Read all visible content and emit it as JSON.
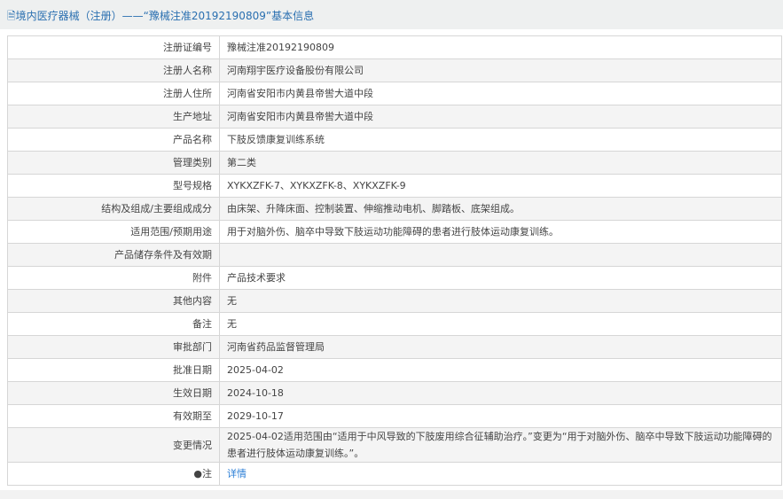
{
  "title": "🗎境内医疗器械（注册）——“豫械注准20192190809”基本信息",
  "rows": [
    {
      "label": "注册证编号",
      "value": "豫械注准20192190809"
    },
    {
      "label": "注册人名称",
      "value": "河南翔宇医疗设备股份有限公司"
    },
    {
      "label": "注册人住所",
      "value": "河南省安阳市内黄县帝喾大道中段"
    },
    {
      "label": "生产地址",
      "value": "河南省安阳市内黄县帝喾大道中段"
    },
    {
      "label": "产品名称",
      "value": "下肢反馈康复训练系统"
    },
    {
      "label": "管理类别",
      "value": "第二类"
    },
    {
      "label": "型号规格",
      "value": "XYKXZFK-7、XYKXZFK-8、XYKXZFK-9"
    },
    {
      "label": "结构及组成/主要组成成分",
      "value": "由床架、升降床面、控制装置、伸缩推动电机、脚踏板、底架组成。"
    },
    {
      "label": "适用范围/预期用途",
      "value": "用于对脑外伤、脑卒中导致下肢运动功能障碍的患者进行肢体运动康复训练。"
    },
    {
      "label": "产品储存条件及有效期",
      "value": ""
    },
    {
      "label": "附件",
      "value": "产品技术要求"
    },
    {
      "label": "其他内容",
      "value": "无"
    },
    {
      "label": "备注",
      "value": "无"
    },
    {
      "label": "审批部门",
      "value": "河南省药品监督管理局"
    },
    {
      "label": "批准日期",
      "value": "2025-04-02"
    },
    {
      "label": "生效日期",
      "value": "2024-10-18"
    },
    {
      "label": "有效期至",
      "value": "2029-10-17"
    },
    {
      "label": "变更情况",
      "value": "2025-04-02适用范围由“适用于中风导致的下肢废用综合征辅助治疗。”变更为“用于对脑外伤、脑卒中导致下肢运动功能障碍的患者进行肢体运动康复训练。”。"
    }
  ],
  "note": {
    "label": "●注",
    "link": "详情"
  }
}
